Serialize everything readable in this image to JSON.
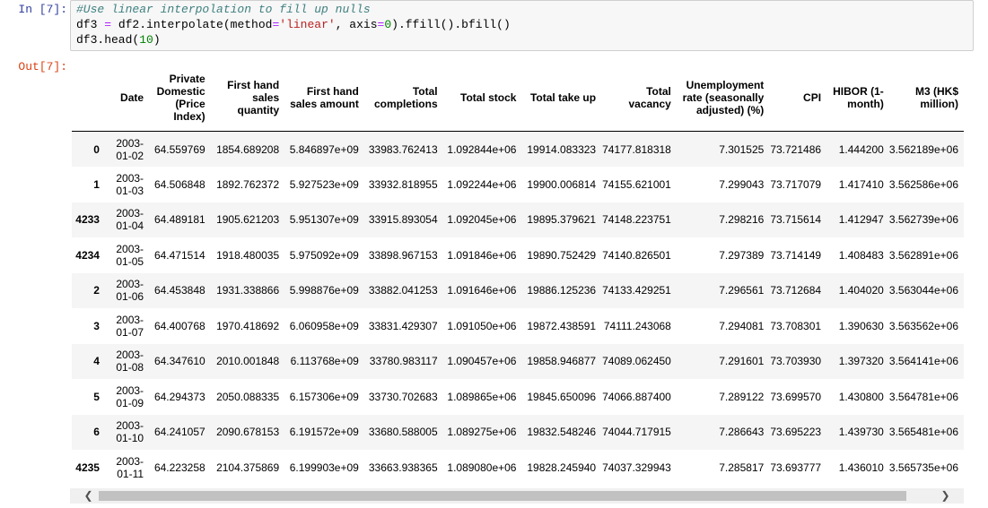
{
  "cell": {
    "in_prompt": "In [7]:",
    "out_prompt": "Out[7]:",
    "code_lines": [
      [
        {
          "t": "#Use linear interpolation to fill up nulls",
          "c": "c-com"
        }
      ],
      [
        {
          "t": "df3 "
        },
        {
          "t": "=",
          "c": "c-op"
        },
        {
          "t": " df2.interpolate(method"
        },
        {
          "t": "=",
          "c": "c-op"
        },
        {
          "t": "'linear'",
          "c": "c-str"
        },
        {
          "t": ", axis"
        },
        {
          "t": "=",
          "c": "c-op"
        },
        {
          "t": "0",
          "c": "c-num"
        },
        {
          "t": ").ffill().bfill()"
        }
      ],
      [
        {
          "t": "df3.head("
        },
        {
          "t": "10",
          "c": "c-num"
        },
        {
          "t": ")"
        }
      ]
    ]
  },
  "table": {
    "columns": [
      "",
      "Date",
      "Private Domestic (Price Index)",
      "First hand sales quantity",
      "First hand sales amount",
      "Total completions",
      "Total stock",
      "Total take up",
      "Total vacancy",
      "Unemployment rate (seasonally adjusted) (%)",
      "CPI",
      "HIBOR (1-month)",
      "M3 (HK$ million)"
    ],
    "rows": [
      [
        "0",
        "2003-01-02",
        "64.559769",
        "1854.689208",
        "5.846897e+09",
        "33983.762413",
        "1.092844e+06",
        "19914.083323",
        "74177.818318",
        "7.301525",
        "73.721486",
        "1.444200",
        "3.562189e+06"
      ],
      [
        "1",
        "2003-01-03",
        "64.506848",
        "1892.762372",
        "5.927523e+09",
        "33932.818955",
        "1.092244e+06",
        "19900.006814",
        "74155.621001",
        "7.299043",
        "73.717079",
        "1.417410",
        "3.562586e+06"
      ],
      [
        "4233",
        "2003-01-04",
        "64.489181",
        "1905.621203",
        "5.951307e+09",
        "33915.893054",
        "1.092045e+06",
        "19895.379621",
        "74148.223751",
        "7.298216",
        "73.715614",
        "1.412947",
        "3.562739e+06"
      ],
      [
        "4234",
        "2003-01-05",
        "64.471514",
        "1918.480035",
        "5.975092e+09",
        "33898.967153",
        "1.091846e+06",
        "19890.752429",
        "74140.826501",
        "7.297389",
        "73.714149",
        "1.408483",
        "3.562891e+06"
      ],
      [
        "2",
        "2003-01-06",
        "64.453848",
        "1931.338866",
        "5.998876e+09",
        "33882.041253",
        "1.091646e+06",
        "19886.125236",
        "74133.429251",
        "7.296561",
        "73.712684",
        "1.404020",
        "3.563044e+06"
      ],
      [
        "3",
        "2003-01-07",
        "64.400768",
        "1970.418692",
        "6.060958e+09",
        "33831.429307",
        "1.091050e+06",
        "19872.438591",
        "74111.243068",
        "7.294081",
        "73.708301",
        "1.390630",
        "3.563562e+06"
      ],
      [
        "4",
        "2003-01-08",
        "64.347610",
        "2010.001848",
        "6.113768e+09",
        "33780.983117",
        "1.090457e+06",
        "19858.946877",
        "74089.062450",
        "7.291601",
        "73.703930",
        "1.397320",
        "3.564141e+06"
      ],
      [
        "5",
        "2003-01-09",
        "64.294373",
        "2050.088335",
        "6.157306e+09",
        "33730.702683",
        "1.089865e+06",
        "19845.650096",
        "74066.887400",
        "7.289122",
        "73.699570",
        "1.430800",
        "3.564781e+06"
      ],
      [
        "6",
        "2003-01-10",
        "64.241057",
        "2090.678153",
        "6.191572e+09",
        "33680.588005",
        "1.089275e+06",
        "19832.548246",
        "74044.717915",
        "7.286643",
        "73.695223",
        "1.439730",
        "3.565481e+06"
      ],
      [
        "4235",
        "2003-01-11",
        "64.223258",
        "2104.375869",
        "6.199903e+09",
        "33663.938365",
        "1.089080e+06",
        "19828.245940",
        "74037.329943",
        "7.285817",
        "73.693777",
        "1.436010",
        "3.565735e+06"
      ]
    ]
  },
  "scrollbar": {
    "left_arrow": "left-arrow-icon",
    "right_arrow": "right-arrow-icon"
  }
}
